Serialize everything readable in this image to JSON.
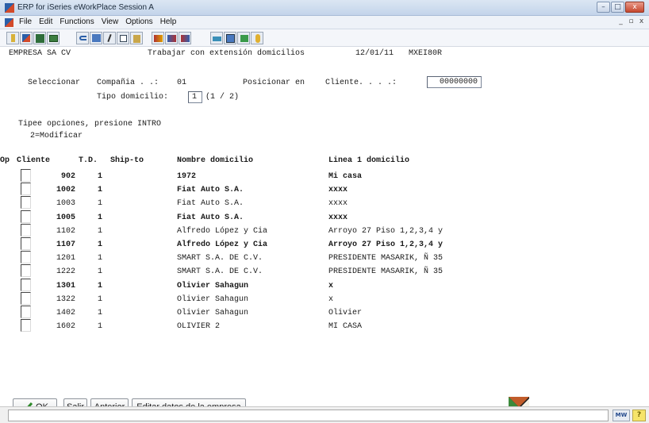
{
  "window": {
    "title": "ERP for iSeries eWorkPlace Session A",
    "controls": [
      "–",
      "□",
      "x"
    ],
    "mdi_controls": [
      "_",
      "▫",
      "x"
    ]
  },
  "menu": [
    "File",
    "Edit",
    "Functions",
    "View",
    "Options",
    "Help"
  ],
  "toolbar_icons": [
    "help-icon",
    "new-session-icon",
    "grid-icon",
    "print-icon",
    "undo-icon",
    "screen-icon",
    "cut-icon",
    "copy-icon",
    "paste-icon",
    "macro-record-icon",
    "macro-play-icon",
    "macro-edit-icon",
    "keyboard-map-icon",
    "settings-icon",
    "check-icon",
    "help-question-icon"
  ],
  "header": {
    "company": "EMPRESA SA CV",
    "screen_title": "Trabajar con extensión domicilios",
    "date": "12/01/11",
    "program": "MXEI80R"
  },
  "selection": {
    "label": "Seleccionar",
    "company_label": "Compañia . .:",
    "company_value": "01",
    "position_label": "Posicionar en",
    "client_label": "Cliente. . . .:",
    "client_value": "00000000",
    "address_type_label": "Tipo domicilio:",
    "address_type_value": "1",
    "address_type_range": "(1 / 2)"
  },
  "instructions": {
    "line1": "Tipee opciones, presione INTRO",
    "line2": "2=Modificar"
  },
  "table": {
    "headers": {
      "op": "Op",
      "client": "Cliente",
      "td": "T.D.",
      "shipto": "Ship-to",
      "name": "Nombre domicilio",
      "address": "Linea 1 domicilio"
    },
    "rows": [
      {
        "client": "902",
        "td": "1",
        "shipto": "",
        "name": "1972",
        "address": "Mi casa",
        "bold": true
      },
      {
        "client": "1002",
        "td": "1",
        "shipto": "",
        "name": "Fiat Auto S.A.",
        "address": "xxxx",
        "bold": true
      },
      {
        "client": "1003",
        "td": "1",
        "shipto": "",
        "name": "Fiat Auto S.A.",
        "address": "xxxx",
        "bold": false
      },
      {
        "client": "1005",
        "td": "1",
        "shipto": "",
        "name": "Fiat Auto S.A.",
        "address": "xxxx",
        "bold": true
      },
      {
        "client": "1102",
        "td": "1",
        "shipto": "",
        "name": "Alfredo López y Cia",
        "address": "Arroyo 27 Piso 1,2,3,4 y",
        "bold": false
      },
      {
        "client": "1107",
        "td": "1",
        "shipto": "",
        "name": "Alfredo López y Cia",
        "address": "Arroyo 27 Piso 1,2,3,4 y",
        "bold": true
      },
      {
        "client": "1201",
        "td": "1",
        "shipto": "",
        "name": "SMART S.A. DE C.V.",
        "address": "PRESIDENTE MASARIK, Ñ 35",
        "bold": false
      },
      {
        "client": "1222",
        "td": "1",
        "shipto": "",
        "name": "SMART S.A. DE C.V.",
        "address": "PRESIDENTE MASARIK, Ñ 35",
        "bold": false
      },
      {
        "client": "1301",
        "td": "1",
        "shipto": "",
        "name": "Olivier Sahagun",
        "address": "x",
        "bold": true
      },
      {
        "client": "1322",
        "td": "1",
        "shipto": "",
        "name": "Olivier Sahagun",
        "address": "x",
        "bold": false
      },
      {
        "client": "1402",
        "td": "1",
        "shipto": "",
        "name": "Olivier Sahagun",
        "address": "Olivier",
        "bold": false
      },
      {
        "client": "1602",
        "td": "1",
        "shipto": "",
        "name": "OLIVIER 2",
        "address": "MI CASA",
        "bold": false
      }
    ]
  },
  "buttons": {
    "ok": "OK",
    "exit": "Salir",
    "previous": "Anterior",
    "edit_company": "Editar datos de la empresa"
  },
  "statusbar": {
    "mw_label": "MW",
    "help_glyph": "?"
  },
  "colors": {
    "ok_check": "#2f8a2a",
    "titlebar": "#c3d4ea"
  }
}
